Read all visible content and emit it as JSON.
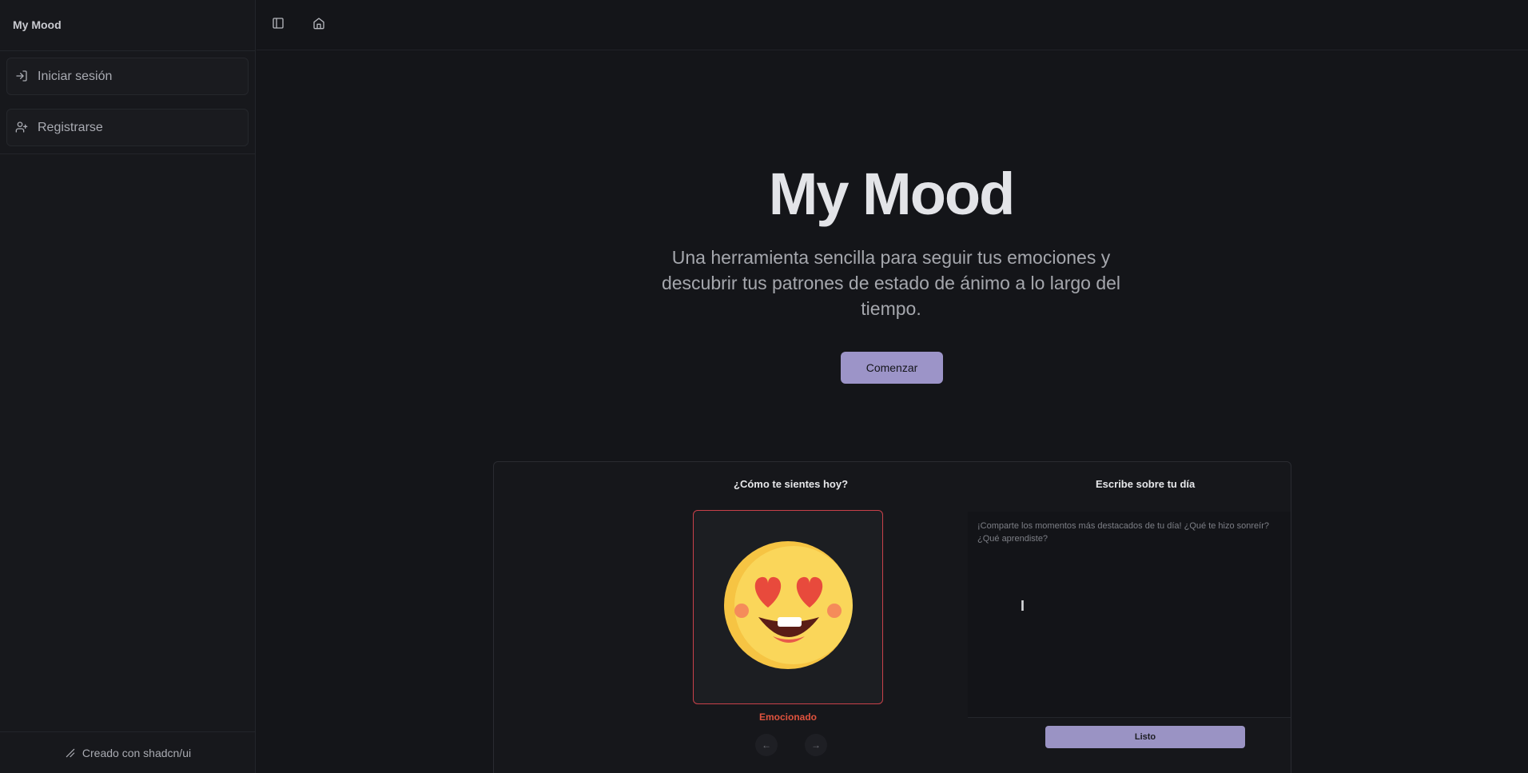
{
  "sidebar": {
    "brand": "My Mood",
    "items": [
      {
        "label": "Iniciar sesión",
        "icon": "login-icon"
      },
      {
        "label": "Registrarse",
        "icon": "user-plus-icon"
      }
    ],
    "footer": {
      "label": "Creado con shadcn/ui",
      "icon": "shadcn-icon"
    }
  },
  "topbar": {
    "icons": [
      "sidebar-toggle-icon",
      "home-icon"
    ]
  },
  "hero": {
    "title": "My Mood",
    "subtitle": "Una herramienta sencilla para seguir tus emociones y descubrir tus patrones de estado de ánimo a lo largo del tiempo.",
    "cta_label": "Comenzar",
    "accent_color": "#9c94c8"
  },
  "preview": {
    "mood_title": "¿Cómo te sientes hoy?",
    "mood_label": "Emocionado",
    "mood_icon": "heart-eyes-emoji-icon",
    "mood_color": "#e0533e",
    "journal_title": "Escribe sobre tu día",
    "journal_placeholder": "¡Comparte los momentos más destacados de tu día! ¿Qué te hizo sonreír? ¿Qué aprendiste?",
    "done_label": "Listo",
    "prev_arrow": "←",
    "next_arrow": "→"
  }
}
